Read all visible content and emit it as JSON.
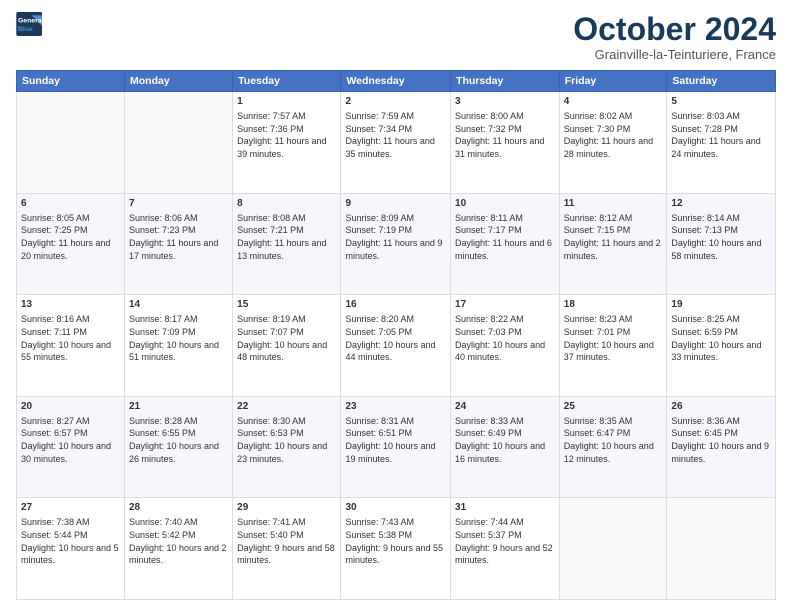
{
  "header": {
    "logo_line1": "General",
    "logo_line2": "Blue",
    "month": "October 2024",
    "location": "Grainville-la-Teinturiere, France"
  },
  "days_of_week": [
    "Sunday",
    "Monday",
    "Tuesday",
    "Wednesday",
    "Thursday",
    "Friday",
    "Saturday"
  ],
  "weeks": [
    [
      {
        "day": "",
        "empty": true
      },
      {
        "day": "",
        "empty": true
      },
      {
        "day": "1",
        "sunrise": "7:57 AM",
        "sunset": "7:36 PM",
        "daylight": "11 hours and 39 minutes."
      },
      {
        "day": "2",
        "sunrise": "7:59 AM",
        "sunset": "7:34 PM",
        "daylight": "11 hours and 35 minutes."
      },
      {
        "day": "3",
        "sunrise": "8:00 AM",
        "sunset": "7:32 PM",
        "daylight": "11 hours and 31 minutes."
      },
      {
        "day": "4",
        "sunrise": "8:02 AM",
        "sunset": "7:30 PM",
        "daylight": "11 hours and 28 minutes."
      },
      {
        "day": "5",
        "sunrise": "8:03 AM",
        "sunset": "7:28 PM",
        "daylight": "11 hours and 24 minutes."
      }
    ],
    [
      {
        "day": "6",
        "sunrise": "8:05 AM",
        "sunset": "7:25 PM",
        "daylight": "11 hours and 20 minutes."
      },
      {
        "day": "7",
        "sunrise": "8:06 AM",
        "sunset": "7:23 PM",
        "daylight": "11 hours and 17 minutes."
      },
      {
        "day": "8",
        "sunrise": "8:08 AM",
        "sunset": "7:21 PM",
        "daylight": "11 hours and 13 minutes."
      },
      {
        "day": "9",
        "sunrise": "8:09 AM",
        "sunset": "7:19 PM",
        "daylight": "11 hours and 9 minutes."
      },
      {
        "day": "10",
        "sunrise": "8:11 AM",
        "sunset": "7:17 PM",
        "daylight": "11 hours and 6 minutes."
      },
      {
        "day": "11",
        "sunrise": "8:12 AM",
        "sunset": "7:15 PM",
        "daylight": "11 hours and 2 minutes."
      },
      {
        "day": "12",
        "sunrise": "8:14 AM",
        "sunset": "7:13 PM",
        "daylight": "10 hours and 58 minutes."
      }
    ],
    [
      {
        "day": "13",
        "sunrise": "8:16 AM",
        "sunset": "7:11 PM",
        "daylight": "10 hours and 55 minutes."
      },
      {
        "day": "14",
        "sunrise": "8:17 AM",
        "sunset": "7:09 PM",
        "daylight": "10 hours and 51 minutes."
      },
      {
        "day": "15",
        "sunrise": "8:19 AM",
        "sunset": "7:07 PM",
        "daylight": "10 hours and 48 minutes."
      },
      {
        "day": "16",
        "sunrise": "8:20 AM",
        "sunset": "7:05 PM",
        "daylight": "10 hours and 44 minutes."
      },
      {
        "day": "17",
        "sunrise": "8:22 AM",
        "sunset": "7:03 PM",
        "daylight": "10 hours and 40 minutes."
      },
      {
        "day": "18",
        "sunrise": "8:23 AM",
        "sunset": "7:01 PM",
        "daylight": "10 hours and 37 minutes."
      },
      {
        "day": "19",
        "sunrise": "8:25 AM",
        "sunset": "6:59 PM",
        "daylight": "10 hours and 33 minutes."
      }
    ],
    [
      {
        "day": "20",
        "sunrise": "8:27 AM",
        "sunset": "6:57 PM",
        "daylight": "10 hours and 30 minutes."
      },
      {
        "day": "21",
        "sunrise": "8:28 AM",
        "sunset": "6:55 PM",
        "daylight": "10 hours and 26 minutes."
      },
      {
        "day": "22",
        "sunrise": "8:30 AM",
        "sunset": "6:53 PM",
        "daylight": "10 hours and 23 minutes."
      },
      {
        "day": "23",
        "sunrise": "8:31 AM",
        "sunset": "6:51 PM",
        "daylight": "10 hours and 19 minutes."
      },
      {
        "day": "24",
        "sunrise": "8:33 AM",
        "sunset": "6:49 PM",
        "daylight": "10 hours and 16 minutes."
      },
      {
        "day": "25",
        "sunrise": "8:35 AM",
        "sunset": "6:47 PM",
        "daylight": "10 hours and 12 minutes."
      },
      {
        "day": "26",
        "sunrise": "8:36 AM",
        "sunset": "6:45 PM",
        "daylight": "10 hours and 9 minutes."
      }
    ],
    [
      {
        "day": "27",
        "sunrise": "7:38 AM",
        "sunset": "5:44 PM",
        "daylight": "10 hours and 5 minutes."
      },
      {
        "day": "28",
        "sunrise": "7:40 AM",
        "sunset": "5:42 PM",
        "daylight": "10 hours and 2 minutes."
      },
      {
        "day": "29",
        "sunrise": "7:41 AM",
        "sunset": "5:40 PM",
        "daylight": "9 hours and 58 minutes."
      },
      {
        "day": "30",
        "sunrise": "7:43 AM",
        "sunset": "5:38 PM",
        "daylight": "9 hours and 55 minutes."
      },
      {
        "day": "31",
        "sunrise": "7:44 AM",
        "sunset": "5:37 PM",
        "daylight": "9 hours and 52 minutes."
      },
      {
        "day": "",
        "empty": true
      },
      {
        "day": "",
        "empty": true
      }
    ]
  ]
}
